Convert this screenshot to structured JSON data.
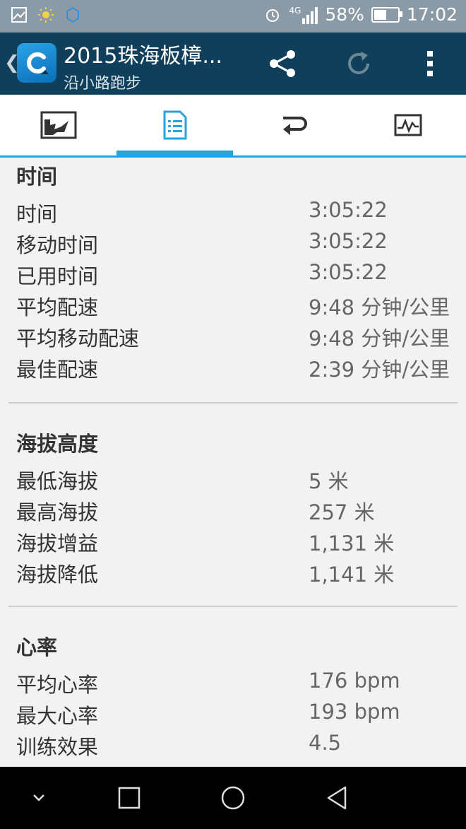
{
  "status_bar": {
    "battery_percent": "58%",
    "battery_level": 0.58,
    "time": "17:02",
    "network_label": "4G"
  },
  "app_bar": {
    "title": "2015珠海板樟...",
    "subtitle": "沿小路跑步",
    "icons": [
      "back-chevron-icon",
      "app-logo-icon",
      "share-icon",
      "refresh-icon",
      "overflow-menu-icon"
    ]
  },
  "tabs": [
    {
      "icon": "map-icon",
      "active": false
    },
    {
      "icon": "details-list-icon",
      "active": true
    },
    {
      "icon": "laps-repeat-icon",
      "active": false
    },
    {
      "icon": "chart-icon",
      "active": false
    }
  ],
  "sections": {
    "time": {
      "title": "时间",
      "rows": [
        {
          "label": "时间",
          "value": "3:05:22"
        },
        {
          "label": "移动时间",
          "value": "3:05:22"
        },
        {
          "label": "已用时间",
          "value": "3:05:22"
        },
        {
          "label": "平均配速",
          "value": "9:48 分钟/公里"
        },
        {
          "label": "平均移动配速",
          "value": "9:48 分钟/公里"
        },
        {
          "label": "最佳配速",
          "value": "2:39 分钟/公里"
        }
      ]
    },
    "elevation": {
      "title": "海拔高度",
      "rows": [
        {
          "label": "最低海拔",
          "value": "5 米"
        },
        {
          "label": "最高海拔",
          "value": "257 米"
        },
        {
          "label": "海拔增益",
          "value": "1,131 米"
        },
        {
          "label": "海拔降低",
          "value": "1,141 米"
        }
      ]
    },
    "heart_rate": {
      "title": "心率",
      "rows": [
        {
          "label": "平均心率",
          "value": "176 bpm"
        },
        {
          "label": "最大心率",
          "value": "193 bpm"
        },
        {
          "label": "训练效果",
          "value": "4.5"
        }
      ]
    }
  },
  "colors": {
    "status_bar": "#8a9aa6",
    "app_bar": "#103f5b",
    "accent": "#29a3dc",
    "background": "#f2f2f2"
  }
}
